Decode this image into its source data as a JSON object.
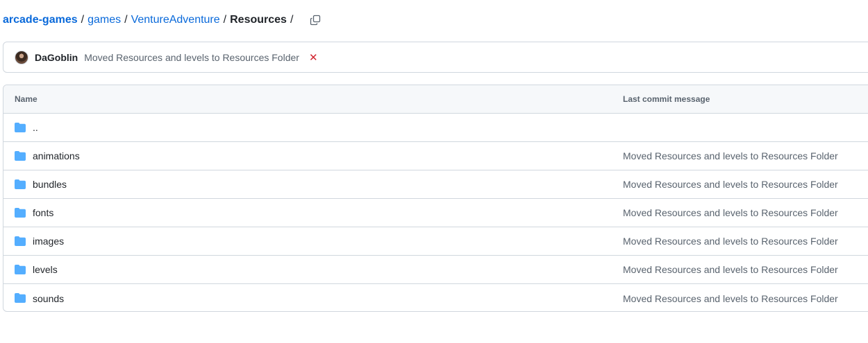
{
  "breadcrumb": {
    "owner": "arcade-games",
    "path": [
      "games",
      "VentureAdventure"
    ],
    "current": "Resources",
    "separator": "/"
  },
  "commit": {
    "author": "DaGoblin",
    "message": "Moved Resources and levels to Resources Folder",
    "status_symbol": "✕",
    "status_color": "#d1242f"
  },
  "table": {
    "columns": [
      "Name",
      "Last commit message"
    ],
    "rows": [
      {
        "name": "..",
        "message": ""
      },
      {
        "name": "animations",
        "message": "Moved Resources and levels to Resources Folder"
      },
      {
        "name": "bundles",
        "message": "Moved Resources and levels to Resources Folder"
      },
      {
        "name": "fonts",
        "message": "Moved Resources and levels to Resources Folder"
      },
      {
        "name": "images",
        "message": "Moved Resources and levels to Resources Folder"
      },
      {
        "name": "levels",
        "message": "Moved Resources and levels to Resources Folder"
      },
      {
        "name": "sounds",
        "message": "Moved Resources and levels to Resources Folder"
      }
    ]
  },
  "colors": {
    "link": "#0969da",
    "folder": "#54aeff",
    "border": "#d0d7de"
  },
  "icons": {
    "folder": "folder-icon",
    "copy": "copy-path-icon",
    "avatar": "avatar"
  }
}
